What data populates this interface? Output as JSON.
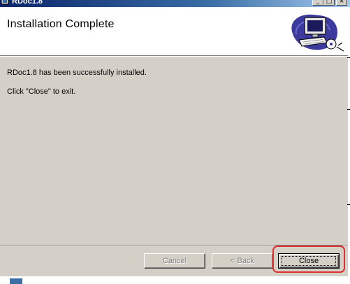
{
  "window": {
    "title": "RDoc1.8",
    "controls": {
      "minimize": "_",
      "maximize": "□",
      "close": "×"
    }
  },
  "header": {
    "title": "Installation Complete",
    "graphic": "computer-setup-icon"
  },
  "body": {
    "line1": "RDoc1.8 has been successfully installed.",
    "line2": "Click \"Close\" to exit."
  },
  "buttons": {
    "cancel": "Cancel",
    "back": "< Back",
    "close": "Close"
  },
  "colors": {
    "highlight": "#e03030",
    "titlebar": "#0a246a",
    "face": "#d4d0c8"
  }
}
